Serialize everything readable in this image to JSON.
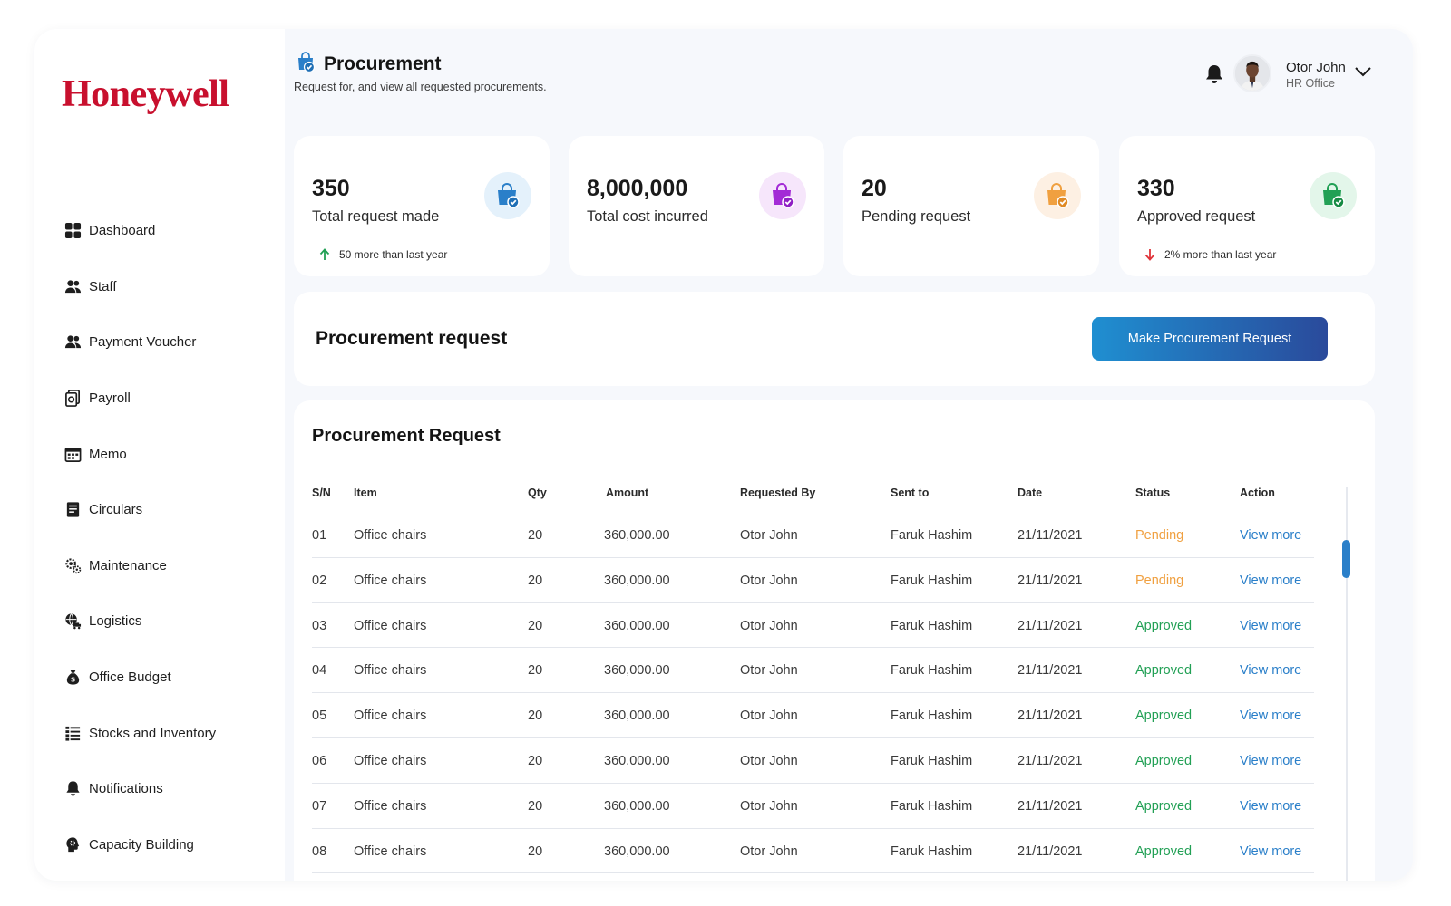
{
  "brand": {
    "name": "Honeywell",
    "color": "#c8102e"
  },
  "sidebar": {
    "items": [
      {
        "label": "Dashboard",
        "icon": "dashboard-grid-icon"
      },
      {
        "label": "Staff",
        "icon": "staff-people-icon"
      },
      {
        "label": "Payment Voucher",
        "icon": "payment-voucher-people-icon"
      },
      {
        "label": "Payroll",
        "icon": "payroll-document-icon"
      },
      {
        "label": "Memo",
        "icon": "memo-calendar-icon"
      },
      {
        "label": "Circulars",
        "icon": "circulars-document-icon"
      },
      {
        "label": "Maintenance",
        "icon": "maintenance-gears-icon"
      },
      {
        "label": "Logistics",
        "icon": "logistics-globe-truck-icon"
      },
      {
        "label": "Office Budget",
        "icon": "money-bag-icon"
      },
      {
        "label": "Stocks and Inventory",
        "icon": "inventory-list-icon"
      },
      {
        "label": "Notifications",
        "icon": "bell-icon"
      },
      {
        "label": "Capacity Building",
        "icon": "head-gear-icon"
      }
    ]
  },
  "header": {
    "title": "Procurement",
    "subtitle": "Request for, and view all requested procurements.",
    "icon": "procurement-bag-check-icon"
  },
  "user": {
    "name": "Otor John",
    "role": "HR Office"
  },
  "stats": [
    {
      "value": "350",
      "label": "Total request made",
      "trend": "50 more than last year",
      "trend_direction": "up",
      "icon_color": "#2a7fc9",
      "icon_bg": "#e4f1fb"
    },
    {
      "value": "8,000,000",
      "label": "Total cost incurred",
      "trend": "",
      "trend_direction": "",
      "icon_color": "#a32bd6",
      "icon_bg": "#f6e6fb"
    },
    {
      "value": "20",
      "label": "Pending request",
      "trend": "",
      "trend_direction": "",
      "icon_color": "#f0a040",
      "icon_bg": "#fdf0e3"
    },
    {
      "value": "330",
      "label": "Approved request",
      "trend": "2% more than last year",
      "trend_direction": "down",
      "icon_color": "#22a055",
      "icon_bg": "#e3f6ea"
    }
  ],
  "banner": {
    "title": "Procurement request",
    "button_label": "Make Procurement Request"
  },
  "table": {
    "title": "Procurement Request",
    "columns": [
      "S/N",
      "Item",
      "Qty",
      "Amount",
      "Requested By",
      "Sent to",
      "Date",
      "Status",
      "Action"
    ],
    "rows": [
      {
        "sn": "01",
        "item": "Office chairs",
        "qty": "20",
        "amount": "360,000.00",
        "requested_by": "Otor John",
        "sent_to": "Faruk Hashim",
        "date": "21/11/2021",
        "status": "Pending",
        "action": "View more"
      },
      {
        "sn": "02",
        "item": "Office chairs",
        "qty": "20",
        "amount": "360,000.00",
        "requested_by": "Otor John",
        "sent_to": "Faruk Hashim",
        "date": "21/11/2021",
        "status": "Pending",
        "action": "View more"
      },
      {
        "sn": "03",
        "item": "Office chairs",
        "qty": "20",
        "amount": "360,000.00",
        "requested_by": "Otor John",
        "sent_to": "Faruk Hashim",
        "date": "21/11/2021",
        "status": "Approved",
        "action": "View more"
      },
      {
        "sn": "04",
        "item": "Office chairs",
        "qty": "20",
        "amount": "360,000.00",
        "requested_by": "Otor John",
        "sent_to": "Faruk Hashim",
        "date": "21/11/2021",
        "status": "Approved",
        "action": "View more"
      },
      {
        "sn": "05",
        "item": "Office chairs",
        "qty": "20",
        "amount": "360,000.00",
        "requested_by": "Otor John",
        "sent_to": "Faruk Hashim",
        "date": "21/11/2021",
        "status": "Approved",
        "action": "View more"
      },
      {
        "sn": "06",
        "item": "Office chairs",
        "qty": "20",
        "amount": "360,000.00",
        "requested_by": "Otor John",
        "sent_to": "Faruk Hashim",
        "date": "21/11/2021",
        "status": "Approved",
        "action": "View more"
      },
      {
        "sn": "07",
        "item": "Office chairs",
        "qty": "20",
        "amount": "360,000.00",
        "requested_by": "Otor John",
        "sent_to": "Faruk Hashim",
        "date": "21/11/2021",
        "status": "Approved",
        "action": "View more"
      },
      {
        "sn": "08",
        "item": "Office chairs",
        "qty": "20",
        "amount": "360,000.00",
        "requested_by": "Otor John",
        "sent_to": "Faruk Hashim",
        "date": "21/11/2021",
        "status": "Approved",
        "action": "View more"
      }
    ]
  },
  "colors": {
    "accent": "#2a7fc9",
    "pending": "#f0a040",
    "approved": "#22a055",
    "trend_up": "#22a055",
    "trend_down": "#e0343a"
  }
}
